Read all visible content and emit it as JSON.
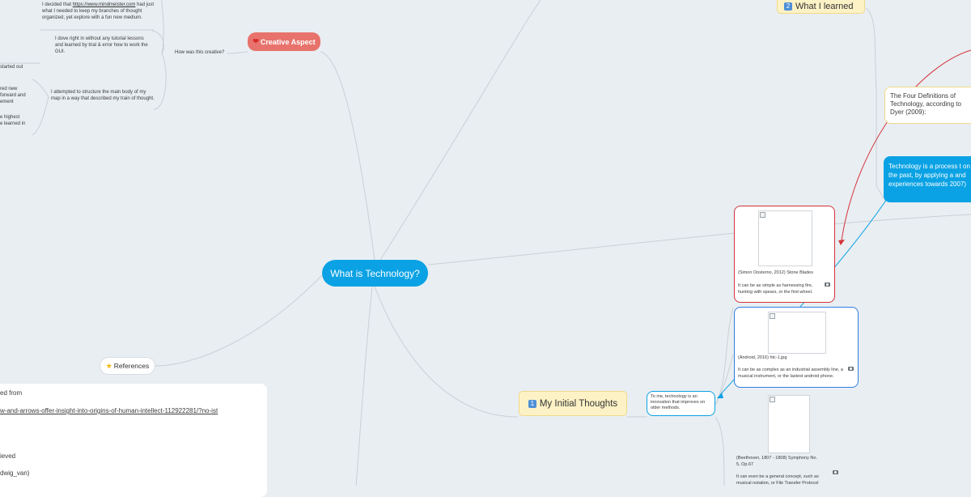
{
  "root": {
    "label": "What is Technology?"
  },
  "creative": {
    "label": "Creative Aspect",
    "icon": "heart-icon",
    "question": "How was this creative?",
    "notes": [
      {
        "prefix": "I decided that ",
        "link": "https://www.mindmeister.com",
        "text": " had just what I needed to keep my branches of thought organized, yet explore with a fun new medium."
      },
      {
        "text": "I dove right in without any tutorial lessons and learned by trial & error how to work the GUI."
      },
      {
        "text": "I attempted to structure the main body of my map in a way that described my train of thought."
      }
    ],
    "fragments": [
      "started out",
      "red new",
      "forward and",
      "ement",
      "e highest",
      "e learned in"
    ]
  },
  "references": {
    "label": "References",
    "icon": "star-icon",
    "lines": [
      "ed from",
      "w-and-arrows-offer-insight-into-origins-of-human-intellect-112922281/?no-ist",
      "ieved",
      "dwig_van)"
    ]
  },
  "learned": {
    "badge": "2",
    "label": "What I learned"
  },
  "four_defs": {
    "text": "The Four Definitions of Technology, according to Dyer (2009):"
  },
  "process": {
    "text": "Technology is a process t on the past, by applying a and experiences towards 2007)"
  },
  "initial": {
    "badge": "1",
    "label": "My Initial Thoughts",
    "opinion": "To me, technology is an innovation that improves on older methods.",
    "cards": [
      {
        "caption": "(Simon Oosterno, 2012) Stone Blades",
        "note": "It can be as simple as harnessing fire, hunting with spears, or the first wheel."
      },
      {
        "caption": "(Android, 2016) htc-1.jpg",
        "note": "It can be as complex as an industrial assembly line, a musical instrument, or the lastest android phone."
      },
      {
        "caption": "(Beethoven, 1807 - 1808) Symphony No. 5, Op.67",
        "note": "It can even be a general concept, such as musical notation, or File Transfer Protocol"
      }
    ]
  },
  "colors": {
    "root": "#0aa2e4",
    "creative": "#e8736c",
    "red_border": "#d4323b",
    "blue_border": "#2f7de1",
    "yellow_bg": "#fdf2c6",
    "connector": "#c7cfd6"
  }
}
